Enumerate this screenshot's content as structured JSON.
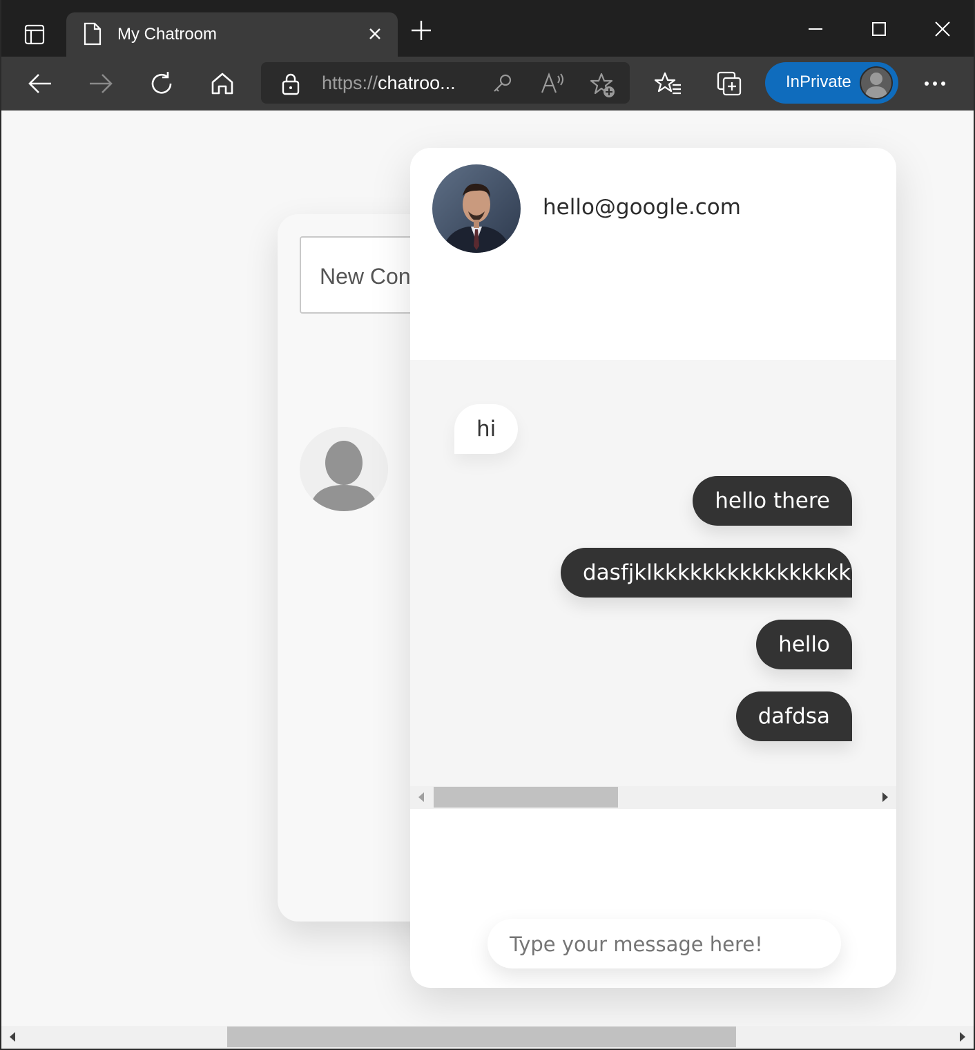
{
  "browser": {
    "tab_title": "My Chatroom",
    "url_protocol": "https://",
    "url_host": "chatroo...",
    "inprivate_label": "InPrivate"
  },
  "sidebar": {
    "new_conversation_placeholder": "New Con"
  },
  "chat": {
    "header_email": "hello@google.com",
    "messages": [
      {
        "text": "hi",
        "direction": "incoming"
      },
      {
        "text": "hello there",
        "direction": "outgoing"
      },
      {
        "text": "dasfjklkkkkkkkkkkkkkkkkkkkkk",
        "direction": "outgoing"
      },
      {
        "text": "hello",
        "direction": "outgoing"
      },
      {
        "text": "dafdsa",
        "direction": "outgoing"
      }
    ],
    "composer_placeholder": "Type your message here!"
  },
  "colors": {
    "accent_inprivate": "#0f6cbd",
    "bubble_outgoing": "#333333",
    "bubble_incoming": "#ffffff"
  },
  "icons": {
    "tab_actions": "tab-actions-icon",
    "page": "page-icon",
    "close": "close-icon",
    "new_tab": "plus-icon",
    "back": "back-arrow-icon",
    "forward": "forward-arrow-icon",
    "refresh": "refresh-icon",
    "home": "home-icon",
    "lock": "lock-icon",
    "key": "key-icon",
    "read_aloud": "read-aloud-icon",
    "add_favorite": "star-plus-icon",
    "favorites": "favorites-icon",
    "collections": "collections-icon",
    "more": "more-icon"
  }
}
